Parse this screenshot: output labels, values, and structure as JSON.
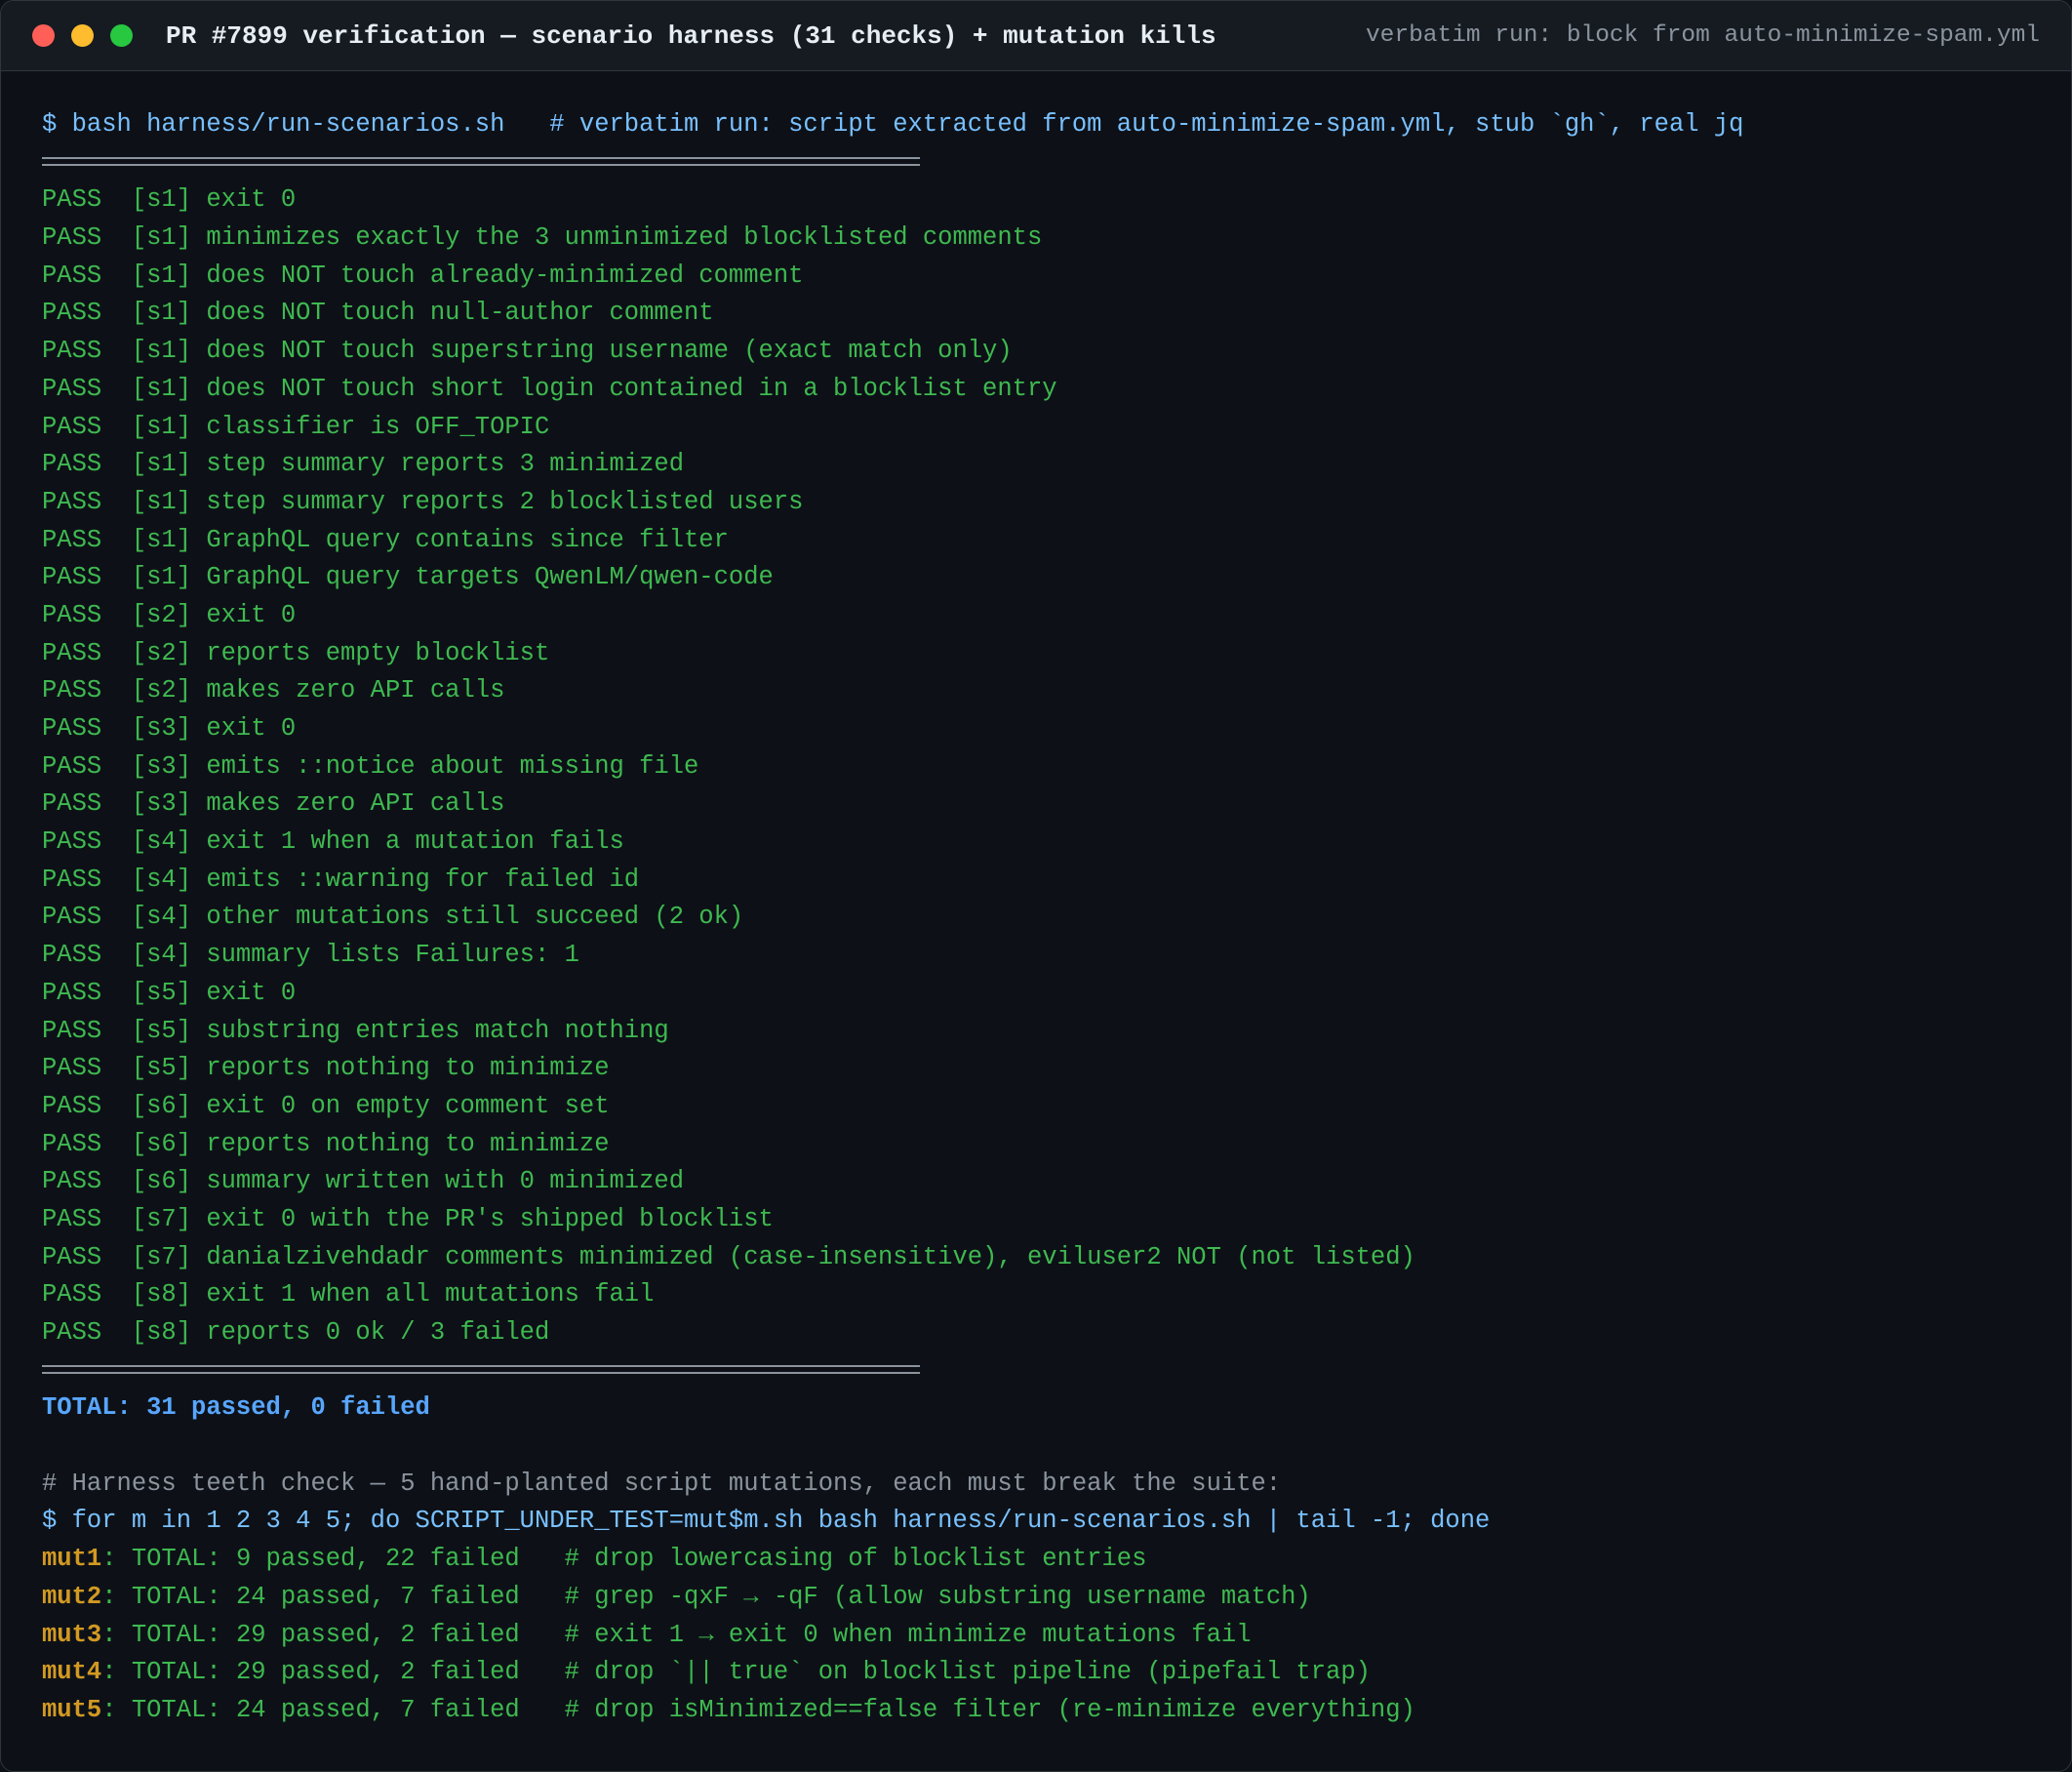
{
  "window": {
    "title": "PR #7899 verification — scenario harness (31 checks) + mutation kills",
    "subtitle": "verbatim run: block from auto-minimize-spam.yml"
  },
  "terminal": {
    "command1": "$ bash harness/run-scenarios.sh   # verbatim run: script extracted from auto-minimize-spam.yml, stub `gh`, real jq",
    "checks": [
      "PASS  [s1] exit 0",
      "PASS  [s1] minimizes exactly the 3 unminimized blocklisted comments",
      "PASS  [s1] does NOT touch already-minimized comment",
      "PASS  [s1] does NOT touch null-author comment",
      "PASS  [s1] does NOT touch superstring username (exact match only)",
      "PASS  [s1] does NOT touch short login contained in a blocklist entry",
      "PASS  [s1] classifier is OFF_TOPIC",
      "PASS  [s1] step summary reports 3 minimized",
      "PASS  [s1] step summary reports 2 blocklisted users",
      "PASS  [s1] GraphQL query contains since filter",
      "PASS  [s1] GraphQL query targets QwenLM/qwen-code",
      "PASS  [s2] exit 0",
      "PASS  [s2] reports empty blocklist",
      "PASS  [s2] makes zero API calls",
      "PASS  [s3] exit 0",
      "PASS  [s3] emits ::notice about missing file",
      "PASS  [s3] makes zero API calls",
      "PASS  [s4] exit 1 when a mutation fails",
      "PASS  [s4] emits ::warning for failed id",
      "PASS  [s4] other mutations still succeed (2 ok)",
      "PASS  [s4] summary lists Failures: 1",
      "PASS  [s5] exit 0",
      "PASS  [s5] substring entries match nothing",
      "PASS  [s5] reports nothing to minimize",
      "PASS  [s6] exit 0 on empty comment set",
      "PASS  [s6] reports nothing to minimize",
      "PASS  [s6] summary written with 0 minimized",
      "PASS  [s7] exit 0 with the PR's shipped blocklist",
      "PASS  [s7] danialzivehdadr comments minimized (case-insensitive), eviluser2 NOT (not listed)",
      "PASS  [s8] exit 1 when all mutations fail",
      "PASS  [s8] reports 0 ok / 3 failed"
    ],
    "total": "TOTAL: 31 passed, 0 failed",
    "comment2": "# Harness teeth check — 5 hand-planted script mutations, each must break the suite:",
    "command2": "$ for m in 1 2 3 4 5; do SCRIPT_UNDER_TEST=mut$m.sh bash harness/run-scenarios.sh | tail -1; done",
    "mutations": [
      {
        "name": "mut1",
        "rest": ": TOTAL: 9 passed, 22 failed   # drop lowercasing of blocklist entries"
      },
      {
        "name": "mut2",
        "rest": ": TOTAL: 24 passed, 7 failed   # grep -qxF → -qF (allow substring username match)"
      },
      {
        "name": "mut3",
        "rest": ": TOTAL: 29 passed, 2 failed   # exit 1 → exit 0 when minimize mutations fail"
      },
      {
        "name": "mut4",
        "rest": ": TOTAL: 29 passed, 2 failed   # drop `|| true` on blocklist pipeline (pipefail trap)"
      },
      {
        "name": "mut5",
        "rest": ": TOTAL: 24 passed, 7 failed   # drop isMinimized==false filter (re-minimize everything)"
      }
    ]
  }
}
